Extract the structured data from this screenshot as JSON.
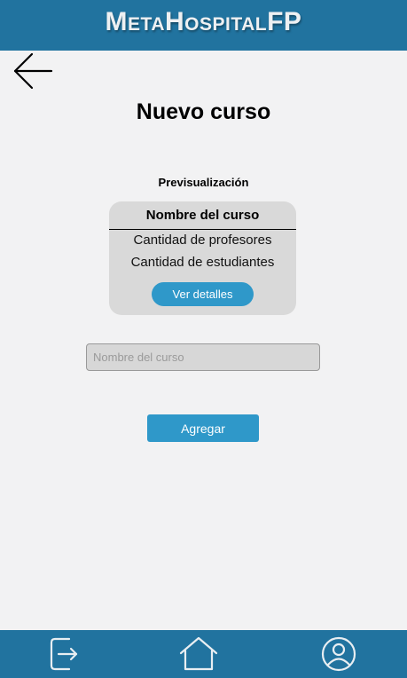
{
  "header": {
    "brand": "MetaHospitalFP"
  },
  "page": {
    "title": "Nuevo curso",
    "back_icon": "arrow-left-icon"
  },
  "preview": {
    "label": "Previsualización",
    "card": {
      "name": "Nombre del curso",
      "teachers": "Cantidad de profesores",
      "students": "Cantidad de estudiantes",
      "details_button": "Ver detalles"
    }
  },
  "form": {
    "name_placeholder": "Nombre del curso",
    "name_value": "",
    "add_button": "Agregar"
  },
  "footer": {
    "icons": [
      "logout-icon",
      "home-icon",
      "profile-icon"
    ]
  },
  "colors": {
    "primary": "#21739f",
    "button": "#2f98c9",
    "background": "#f2f2f3",
    "card": "#d9d9d9"
  }
}
